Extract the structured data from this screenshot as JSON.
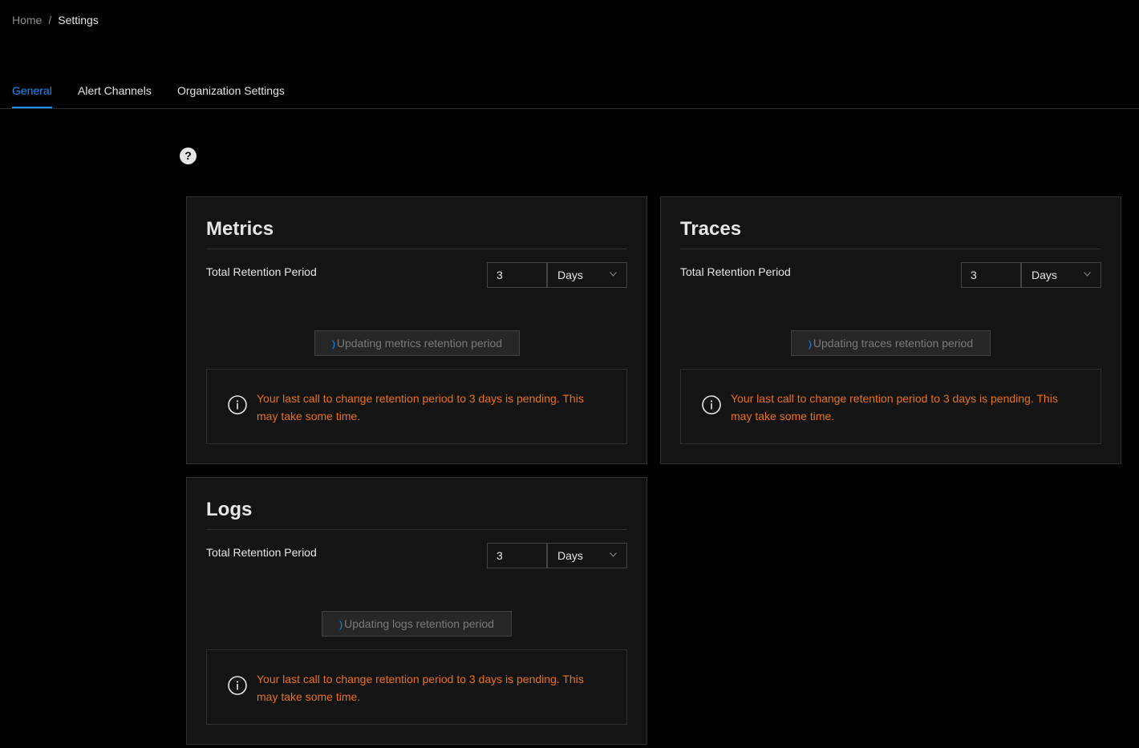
{
  "breadcrumb": {
    "home": "Home",
    "separator": "/",
    "current": "Settings"
  },
  "tabs": [
    {
      "label": "General",
      "active": true
    },
    {
      "label": "Alert Channels",
      "active": false
    },
    {
      "label": "Organization Settings",
      "active": false
    }
  ],
  "help_icon": {
    "glyph": "?"
  },
  "cards": {
    "metrics": {
      "title": "Metrics",
      "retention_label": "Total Retention Period",
      "value": "3",
      "unit": "Days",
      "button_label": "Updating metrics retention period",
      "pending_message": "Your last call to change retention period to 3 days is pending. This may take some time."
    },
    "traces": {
      "title": "Traces",
      "retention_label": "Total Retention Period",
      "value": "3",
      "unit": "Days",
      "button_label": "Updating traces retention period",
      "pending_message": "Your last call to change retention period to 3 days is pending. This may take some time."
    },
    "logs": {
      "title": "Logs",
      "retention_label": "Total Retention Period",
      "value": "3",
      "unit": "Days",
      "button_label": "Updating logs retention period",
      "pending_message": "Your last call to change retention period to 3 days is pending. This may take some time."
    }
  },
  "colors": {
    "background": "#000000",
    "card_background": "#141414",
    "accent": "#1890ff",
    "warning_text": "#e8711a",
    "border": "#303030"
  },
  "icons": {
    "help": "question-circle-icon",
    "info": "info-circle-icon",
    "chevron": "chevron-down-icon",
    "spinner": "loading-spinner-icon"
  }
}
